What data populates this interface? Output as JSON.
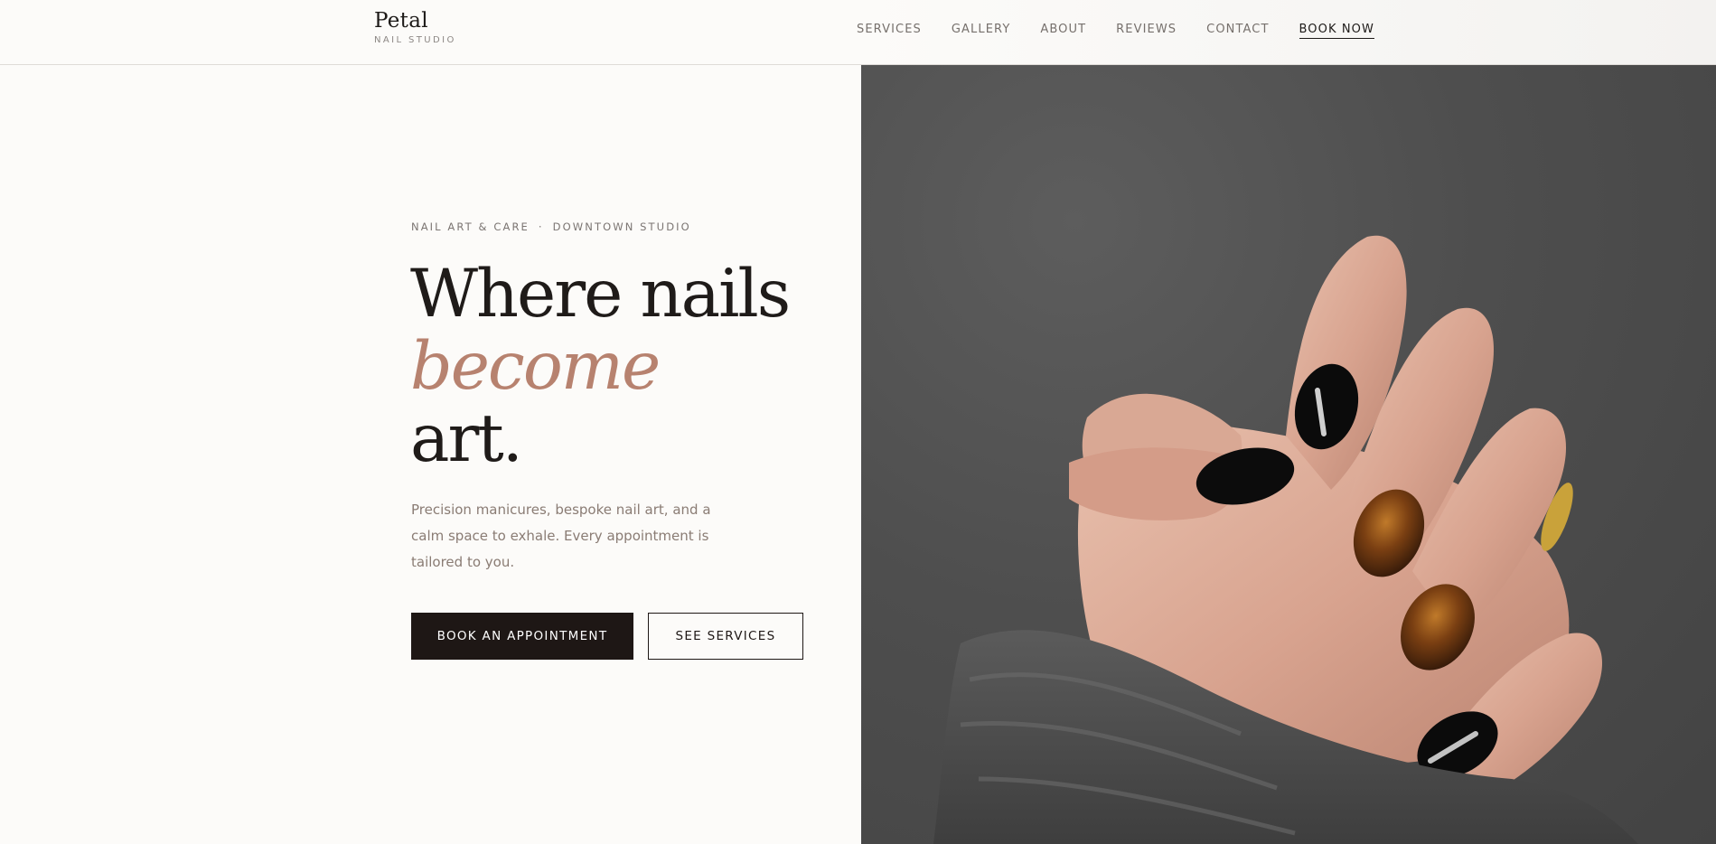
{
  "brand": {
    "name": "Petal",
    "tagline": "NAIL STUDIO"
  },
  "nav": {
    "items": [
      "SERVICES",
      "GALLERY",
      "ABOUT",
      "REVIEWS",
      "CONTACT"
    ],
    "cta": "BOOK NOW"
  },
  "hero": {
    "eyebrow_left": "NAIL ART & CARE",
    "eyebrow_sep": "·",
    "eyebrow_right": "DOWNTOWN STUDIO",
    "headline_line1": "Where nails",
    "headline_accent": "become",
    "headline_line3": "art.",
    "description": "Precision manicures, bespoke nail art, and a calm space to exhale. Every appointment is tailored to you.",
    "primary_button": "BOOK AN APPOINTMENT",
    "secondary_button": "SEE SERVICES"
  },
  "colors": {
    "background": "#fcfbf9",
    "ink": "#1e1715",
    "accent": "#b7826f",
    "muted_text": "#8a7c74"
  },
  "image": {
    "icon": "hand-with-painted-nails"
  }
}
